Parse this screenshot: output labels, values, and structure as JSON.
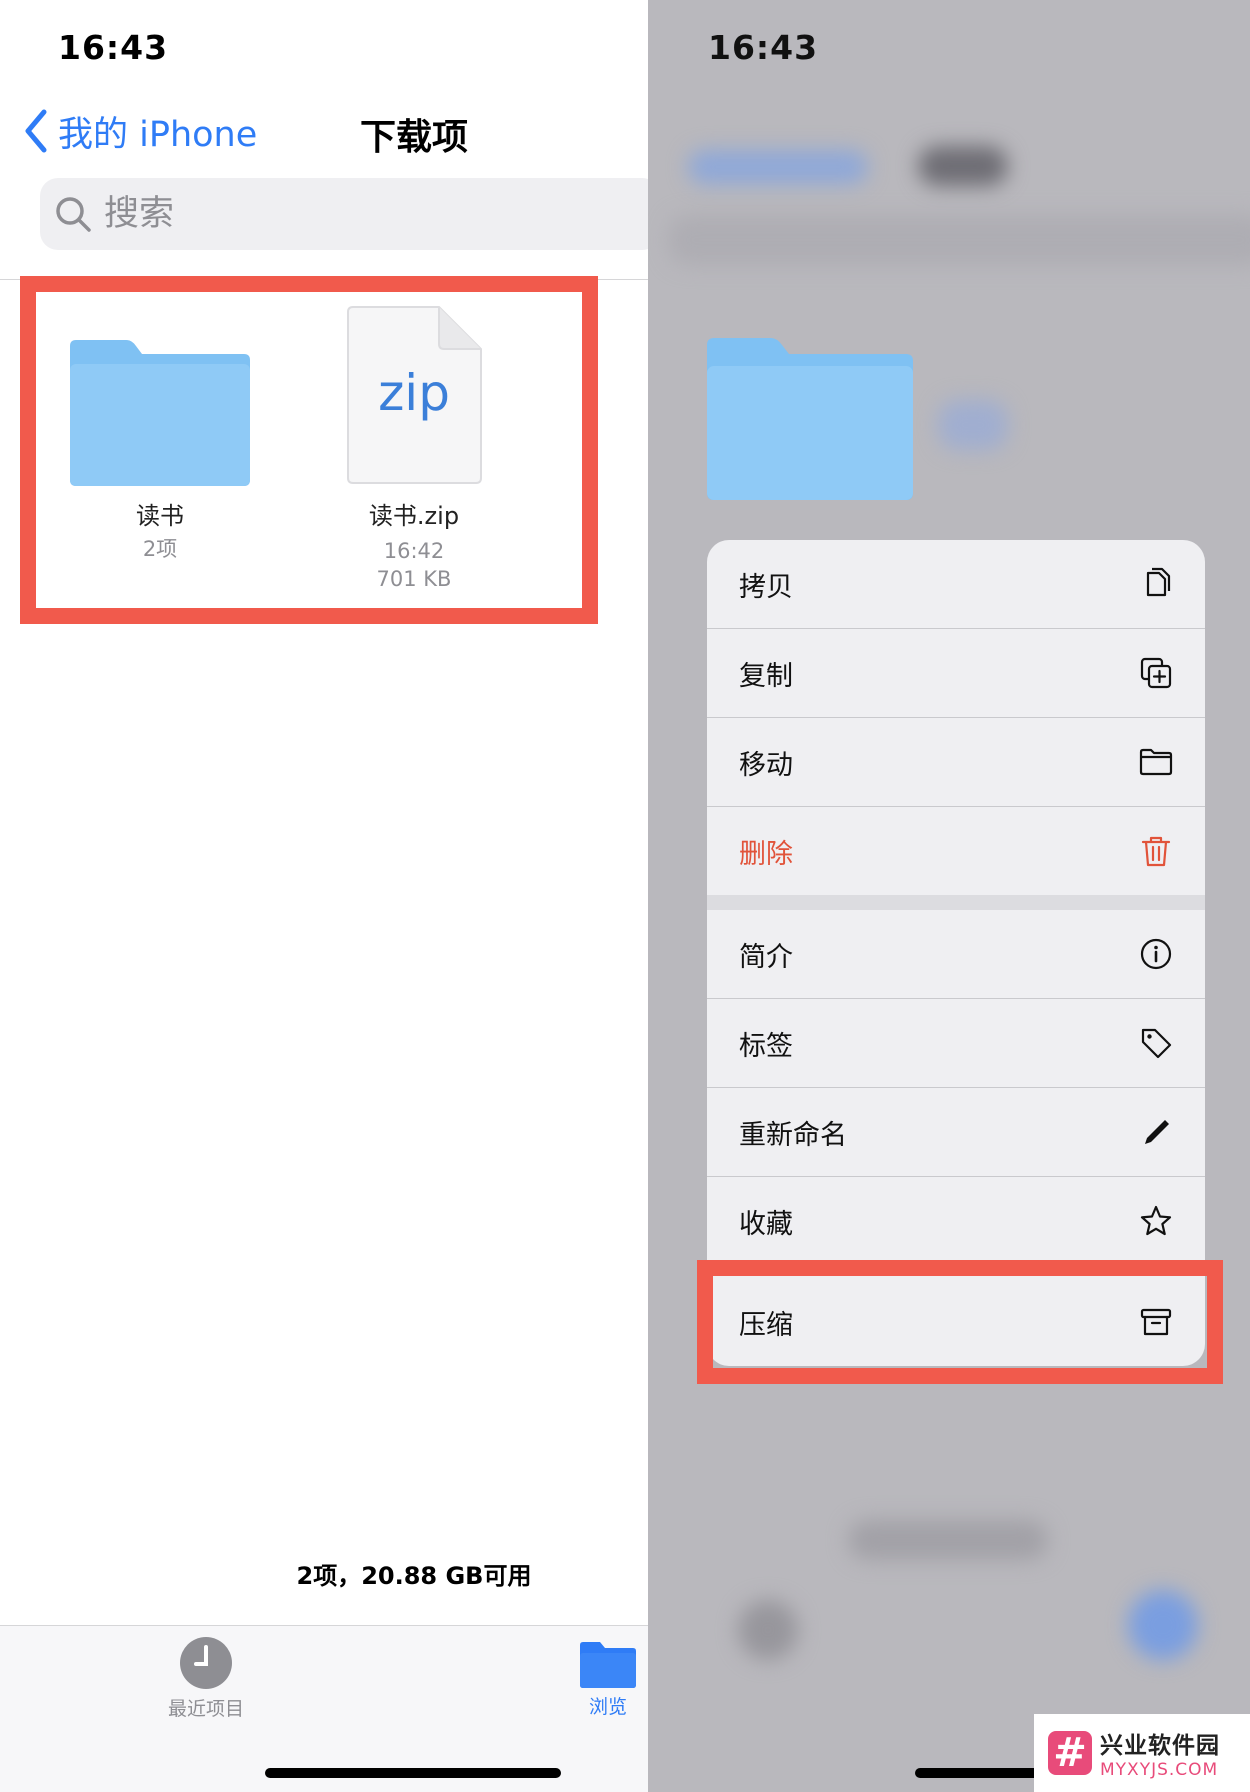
{
  "left": {
    "status_time": "16:43",
    "nav": {
      "back_label": "我的 iPhone",
      "title": "下载项"
    },
    "search": {
      "placeholder": "搜索"
    },
    "files": [
      {
        "name": "读书",
        "meta1": "2项",
        "meta2": ""
      },
      {
        "name": "读书.zip",
        "meta1": "16:42",
        "meta2": "701 KB",
        "badge": "zip"
      }
    ],
    "footer_info": "2项，20.88 GB可用",
    "tabs": [
      {
        "label": "最近项目",
        "icon": "clock-icon"
      },
      {
        "label": "浏览",
        "icon": "folder-icon"
      }
    ]
  },
  "right": {
    "status_time": "16:43",
    "menu": [
      {
        "label": "拷贝",
        "icon": "copy-icon"
      },
      {
        "label": "复制",
        "icon": "duplicate-icon"
      },
      {
        "label": "移动",
        "icon": "folder-icon"
      },
      {
        "label": "删除",
        "icon": "trash-icon",
        "color": "#e1533a"
      },
      {
        "label": "简介",
        "icon": "info-icon"
      },
      {
        "label": "标签",
        "icon": "tag-icon"
      },
      {
        "label": "重新命名",
        "icon": "pencil-icon"
      },
      {
        "label": "收藏",
        "icon": "star-icon"
      },
      {
        "label": "压缩",
        "icon": "archive-icon"
      }
    ]
  },
  "watermark": {
    "line1": "兴业软件园",
    "line2": "MYXYJS.COM"
  },
  "colors": {
    "accent": "#2f7cf6",
    "destructive": "#e1533a",
    "highlight": "#f15a4c",
    "folder": "#8fcaf6"
  }
}
